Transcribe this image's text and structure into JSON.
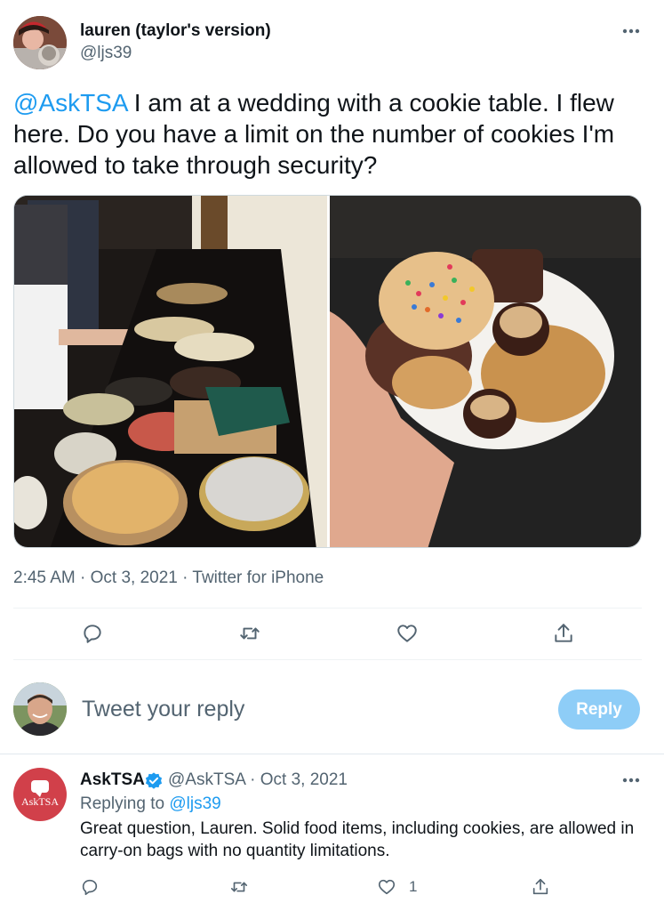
{
  "tweet": {
    "author_name": "lauren (taylor's version)",
    "author_handle": "@ljs39",
    "text_mention": "@AskTSA",
    "text_body": " I am at a wedding with a cookie table. I flew here. Do you have a limit on the number of cookies I'm allowed to take through security?",
    "time": "2:45 AM",
    "date": "Oct 3, 2021",
    "source": "Twitter for iPhone",
    "more_icon": "more-horizontal-icon"
  },
  "compose": {
    "placeholder": "Tweet your reply",
    "button_label": "Reply"
  },
  "reply": {
    "avatar_label": "AskTSA",
    "author_name": "AskTSA",
    "author_handle": "@AskTSA",
    "date": "Oct 3, 2021",
    "replying_prefix": "Replying to",
    "replying_to": "@ljs39",
    "text": "Great question, Lauren. Solid food items, including cookies, are allowed in carry-on bags with no quantity limitations.",
    "like_count": "1"
  },
  "colors": {
    "accent": "#1d9bf0",
    "secondary_text": "#536471",
    "reply_button_disabled": "#8ecdf7",
    "asktsa_avatar": "#d1404a"
  }
}
